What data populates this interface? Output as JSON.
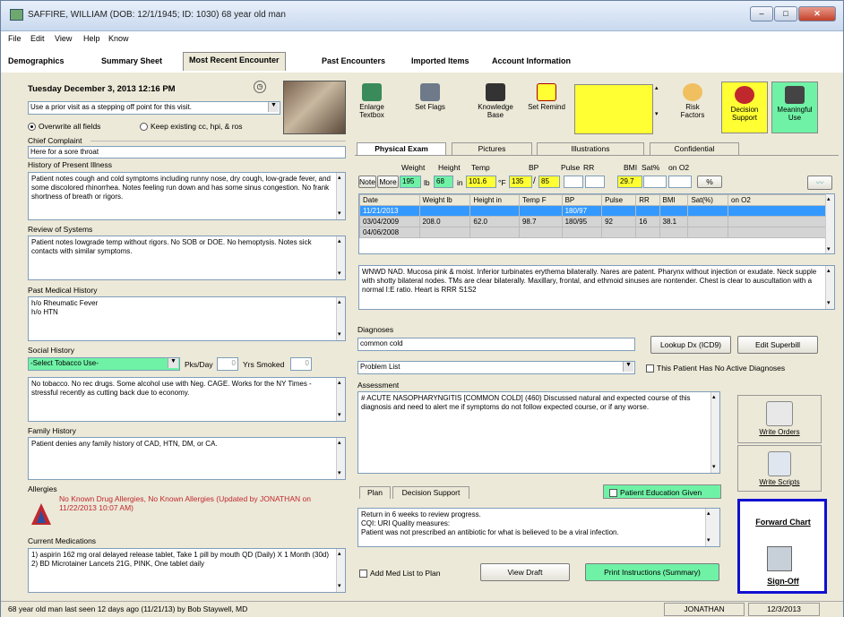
{
  "window": {
    "title": "SAFFIRE, WILLIAM (DOB: 12/1/1945; ID: 1030) 68 year old man"
  },
  "menu": [
    "File",
    "Edit",
    "View",
    "Help",
    "Know"
  ],
  "tabs": [
    "Demographics",
    "Summary Sheet",
    "Most Recent Encounter",
    "Past Encounters",
    "Imported Items",
    "Account Information"
  ],
  "encounter": {
    "date": "Tuesday December 3, 2013  12:16 PM",
    "prior_visit": "Use a prior visit as a stepping off point for this visit.",
    "overwrite": "Overwrite all fields",
    "keep": "Keep existing cc, hpi, & ros"
  },
  "left": {
    "chief_complaint_label": "Chief Complaint",
    "chief_complaint": "Here for a sore throat",
    "hpi_label": "History of Present Illness",
    "hpi": "Patient notes cough and cold symptoms including runny nose, dry cough, low-grade fever, and some discolored rhinorrhea. Notes feeling run down and has some sinus congestion. No frank shortness of breath or rigors.",
    "ros_label": "Review of Systems",
    "ros": "Patient notes lowgrade temp without rigors. No SOB or DOE. No hemoptysis. Notes sick contacts with similar symptoms.",
    "pmh_label": "Past Medical History",
    "pmh": "h/o Rheumatic Fever\nh/o HTN",
    "social_label": "Social History",
    "tobacco_select": "-Select Tobacco Use-",
    "pks_label": "Pks/Day",
    "pks_value": "0",
    "yrs_label": "Yrs Smoked",
    "yrs_value": "0",
    "social": "No tobacco. No rec drugs. Some alcohol use with Neg. CAGE. Works for the NY Times - stressful recently as cutting back due to economy.",
    "family_label": "Family History",
    "family": "Patient denies any family history of CAD, HTN, DM, or CA.",
    "allergies_label": "Allergies",
    "allergies": "No Known Drug Allergies, No Known Allergies (Updated by JONATHAN on 11/22/2013 10:07 AM)",
    "meds_label": "Current Medications",
    "meds": "1) aspirin 162 mg oral delayed release tablet, Take 1 pill by mouth QD (Daily) X 1 Month (30d)\n2) BD Microtainer Lancets 21G, PINK, One tablet daily"
  },
  "toolbar": {
    "enlarge": "Enlarge\nTextbox",
    "flags": "Set Flags",
    "knowledge": "Knowledge\nBase",
    "remind": "Set Remind",
    "risk": "Risk\nFactors",
    "decision": "Decision\nSupport",
    "meaningful": "Meaningful\nUse"
  },
  "subtabs": [
    "Physical Exam",
    "Pictures",
    "Illustrations",
    "Confidential"
  ],
  "vitals": {
    "headers": [
      "Weight",
      "Height",
      "Temp",
      "BP",
      "Pulse",
      "RR",
      "BMI",
      "Sat%",
      "on O2"
    ],
    "note": "Note",
    "more": "More",
    "weight": "195",
    "wt_unit": "lb",
    "height": "68",
    "ht_unit": "in",
    "temp": "101.6",
    "temp_unit": "°F",
    "bp_sys": "135",
    "bp_dia": "85",
    "bmi": "29.7",
    "sat_unit": "%"
  },
  "vitals_table": {
    "columns": [
      "Date",
      "Weight lb",
      "Height in",
      "Temp F",
      "BP",
      "Pulse",
      "RR",
      "BMI",
      "Sat(%)",
      "on O2"
    ],
    "rows": [
      [
        "11/21/2013",
        "",
        "",
        "",
        "180/97",
        "",
        "",
        "",
        "",
        ""
      ],
      [
        "03/04/2009",
        "208.0",
        "62.0",
        "98.7",
        "180/95",
        "92",
        "16",
        "38.1",
        "",
        ""
      ],
      [
        "04/06/2008",
        "",
        "",
        "",
        "",
        "",
        "",
        "",
        "",
        ""
      ]
    ]
  },
  "exam_text": "WNWD NAD. Mucosa pink & moist. Inferior turbinates erythema bilaterally. Nares are patent. Pharynx without injection or exudate. Neck supple with shotty bilateral nodes. TMs are clear bilaterally. Maxillary, frontal, and ethmoid sinuses are nontender. Chest is clear to auscultation with a normal I:E ratio. Heart is RRR S1S2",
  "diagnoses": {
    "label": "Diagnoses",
    "value": "common cold",
    "lookup": "Lookup Dx (ICD9)",
    "superbill": "Edit Superbill",
    "problem_list": "Problem List",
    "no_active": "This Patient Has No Active Diagnoses"
  },
  "assessment": {
    "label": "Assessment",
    "text": "# ACUTE NASOPHARYNGITIS [COMMON COLD] (460) Discussed natural and expected course of this diagnosis and need to alert me if symptoms do not follow expected course, or if any worse."
  },
  "plan": {
    "tabs": [
      "Plan",
      "Decision Support"
    ],
    "edu": "Patient Education Given",
    "text": "Return in 6 weeks to review progress.\nCQI: URI Quality measures:\nPatient was not prescribed an antibiotic for what is believed to be a viral infection.",
    "add_med": "Add Med List to Plan",
    "view_draft": "View Draft",
    "print": "Print Instructions (Summary)"
  },
  "right_actions": {
    "orders": "Write Orders",
    "scripts": "Write Scripts",
    "forward": "Forward Chart",
    "signoff": "Sign-Off"
  },
  "status": {
    "left": "68 year old man last seen 12 days ago (11/21/13) by Bob Staywell, MD",
    "user": "JONATHAN",
    "date": "12/3/2013"
  },
  "colors": {
    "highlight": "#ffff33",
    "green": "#6ff2a6",
    "selrow": "#3399ff",
    "accent_border": "#1010d0",
    "allergy_red": "#c0282e"
  }
}
